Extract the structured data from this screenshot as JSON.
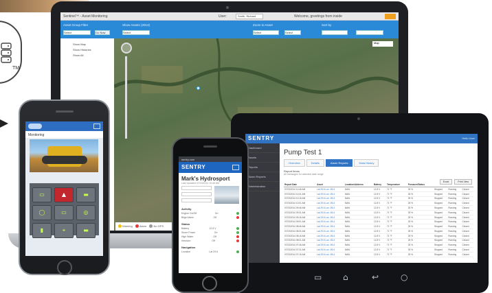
{
  "laptop": {
    "title": "Sentinel™ - Asset Monitoring",
    "user_label": "User:",
    "user_select": "Smith, Richard",
    "welcome": "Welcome, greetings from inside",
    "account_select": "Main Fleet",
    "toolbar": {
      "filter_label": "Asset Group Filter",
      "go_button": "Go Now",
      "asset_filter": "Show Assets (2013)",
      "zoom_label": "Zoom to Asset",
      "zoom_select": "Select",
      "sort_label": "Sort by",
      "select1": "Select",
      "select2": "Select",
      "select3": "Select"
    },
    "sidebar": {
      "items": [
        "Show Map",
        "Show Histories",
        "Show All"
      ]
    },
    "map_button": "Map",
    "status": {
      "warning": "Warning",
      "alarm": "Alarm",
      "no_gps": "No GPS"
    }
  },
  "tablet": {
    "brand": "SENTRY",
    "user_link": "Hello User",
    "nav_items": [
      "Dashboard",
      "Assets",
      "Reports",
      "Alarm Reports",
      "Administration"
    ],
    "page_title": "Pump Test 1",
    "tabs": [
      {
        "label": "Overview",
        "active": false
      },
      {
        "label": "Details",
        "active": false
      },
      {
        "label": "Alarm Reports",
        "active": true
      },
      {
        "label": "Data History",
        "active": false
      }
    ],
    "report_heading": "Report Items",
    "report_sub": "All messages for selected date range",
    "tools": [
      "Excel",
      "Print View"
    ],
    "table": {
      "headers": [
        "Report Date",
        "Asset",
        "Location/Address",
        "Battery",
        "Temperature",
        "Pressure/Status",
        "",
        "",
        ""
      ],
      "rows": [
        [
          "07/23/2014 10:46 AM",
          "Lat 29.6 Lon -95.4",
          "MAN",
          "12.8 V",
          "71 °F",
          "25 %",
          "Stopped",
          "Running",
          "Closed"
        ],
        [
          "07/23/2014 10:31 AM",
          "Lat 29.6 Lon -95.4",
          "MAN",
          "12.8 V",
          "71 °F",
          "25 %",
          "Stopped",
          "Running",
          "Closed"
        ],
        [
          "07/23/2014 10:16 AM",
          "Lat 29.6 Lon -95.4",
          "MAN",
          "12.8 V",
          "71 °F",
          "25 %",
          "Stopped",
          "Running",
          "Closed"
        ],
        [
          "07/23/2014 10:01 AM",
          "Lat 29.6 Lon -95.4",
          "MAN",
          "12.8 V",
          "71 °F",
          "25 %",
          "Stopped",
          "Running",
          "Closed"
        ],
        [
          "07/23/2014 09:46 AM",
          "Lat 29.6 Lon -95.4",
          "MAN",
          "12.8 V",
          "71 °F",
          "25 %",
          "Stopped",
          "Running",
          "Closed"
        ],
        [
          "07/23/2014 09:31 AM",
          "Lat 29.6 Lon -95.4",
          "MAN",
          "12.8 V",
          "71 °F",
          "25 %",
          "Stopped",
          "Running",
          "Closed"
        ],
        [
          "07/23/2014 09:16 AM",
          "Lat 29.6 Lon -95.4",
          "MAN",
          "12.8 V",
          "71 °F",
          "25 %",
          "Stopped",
          "Running",
          "Closed"
        ],
        [
          "07/23/2014 09:01 AM",
          "Lat 29.6 Lon -95.4",
          "MAN",
          "12.8 V",
          "71 °F",
          "25 %",
          "Stopped",
          "Running",
          "Closed"
        ],
        [
          "07/23/2014 08:46 AM",
          "Lat 29.6 Lon -95.4",
          "MAN",
          "12.8 V",
          "71 °F",
          "25 %",
          "Stopped",
          "Running",
          "Closed"
        ],
        [
          "07/23/2014 08:31 AM",
          "Lat 29.6 Lon -95.4",
          "MAN",
          "12.8 V",
          "71 °F",
          "25 %",
          "Stopped",
          "Running",
          "Closed"
        ],
        [
          "07/23/2014 08:16 AM",
          "Lat 29.6 Lon -95.4",
          "MAN",
          "12.8 V",
          "71 °F",
          "25 %",
          "Stopped",
          "Running",
          "Closed"
        ],
        [
          "07/23/2014 08:01 AM",
          "Lat 29.6 Lon -95.4",
          "MAN",
          "12.8 V",
          "71 °F",
          "25 %",
          "Stopped",
          "Running",
          "Closed"
        ],
        [
          "07/23/2014 07:46 AM",
          "Lat 29.6 Lon -95.4",
          "MAN",
          "12.8 V",
          "71 °F",
          "25 %",
          "Stopped",
          "Running",
          "Closed"
        ],
        [
          "07/23/2014 07:31 AM",
          "Lat 29.6 Lon -95.4",
          "MAN",
          "12.8 V",
          "71 °F",
          "25 %",
          "Stopped",
          "Running",
          "Closed"
        ],
        [
          "07/23/2014 07:16 AM",
          "Lat 29.6 Lon -95.4",
          "MAN",
          "12.8 V",
          "71 °F",
          "25 %",
          "Stopped",
          "Running",
          "Closed"
        ]
      ]
    },
    "softkeys": [
      "▭",
      "⌂",
      "↩",
      "○"
    ]
  },
  "phone_left": {
    "section_label": "Monitoring",
    "tiles": [
      "▭",
      "▲",
      "▬",
      "◯",
      "▭",
      "◎",
      "▮",
      "⌖",
      "▬"
    ]
  },
  "phone_right": {
    "url": "sentry.com",
    "brand": "SENTRY",
    "heading": "Mark's Hydrosport",
    "sub": "Last Updated 07/23/2014 10:46 AM",
    "sections": [
      {
        "title": "Activity",
        "items": [
          [
            "Engine On/Off",
            "On"
          ],
          [
            "Bilge Alarm",
            "Off"
          ]
        ]
      },
      {
        "title": "Status",
        "items": [
          [
            "Battery",
            "12.8 V"
          ],
          [
            "Shore Power",
            "On"
          ],
          [
            "High Water",
            "Off"
          ],
          [
            "Intrusion",
            "Off"
          ]
        ]
      },
      {
        "title": "Navigation",
        "items": [
          [
            "Location",
            "Lat 29.6"
          ]
        ]
      }
    ]
  }
}
